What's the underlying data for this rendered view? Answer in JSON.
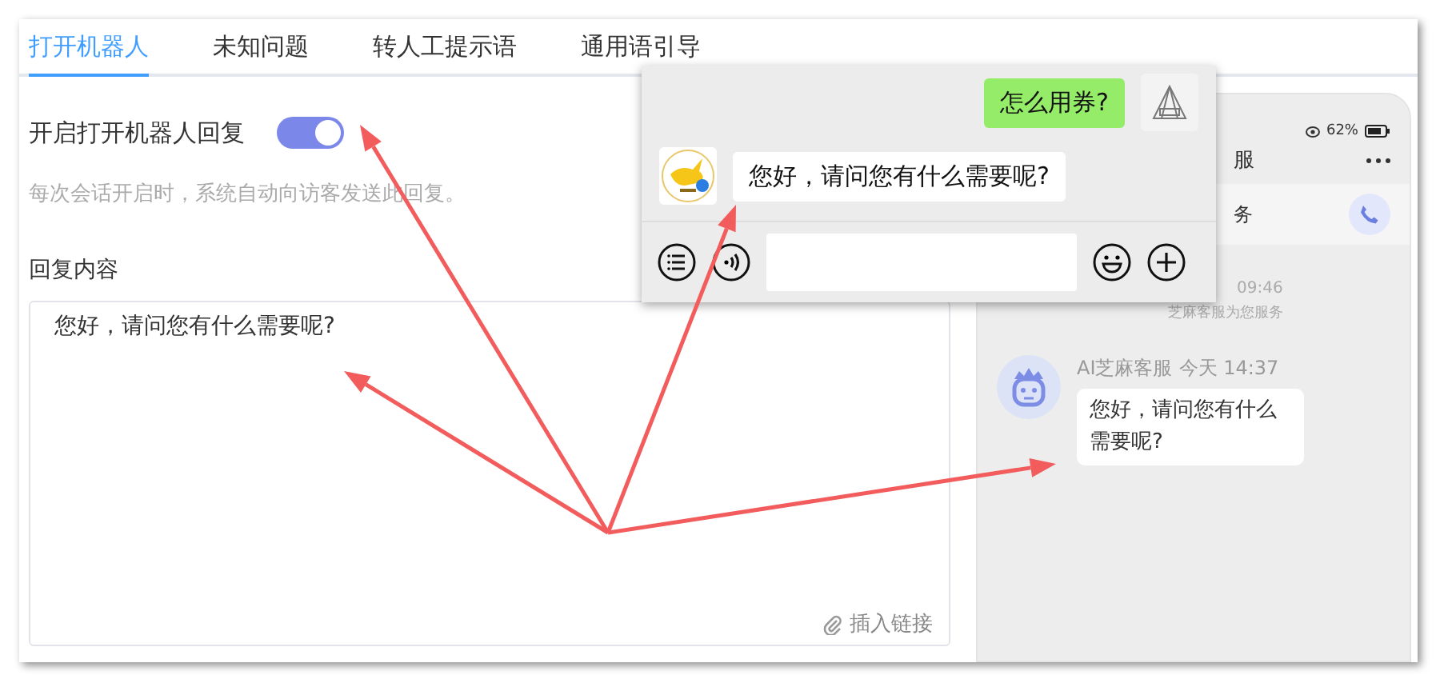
{
  "tabs": [
    {
      "label": "打开机器人",
      "selected": true
    },
    {
      "label": "未知问题",
      "selected": false
    },
    {
      "label": "转人工提示语",
      "selected": false
    },
    {
      "label": "通用语引导",
      "selected": false
    }
  ],
  "auto_reply": {
    "label": "开启打开机器人回复",
    "on": true,
    "hint": "每次会话开启时，系统自动向访客发送此回复。"
  },
  "reply_content": {
    "label": "回复内容",
    "value": "您好，请问您有什么需要呢?",
    "insert_link": "插入链接"
  },
  "chat_popup": {
    "messages": [
      {
        "kind": "sent",
        "text": "怎么用券?"
      },
      {
        "kind": "received",
        "text": "您好，请问您有什么需要呢?"
      }
    ]
  },
  "phone_preview": {
    "battery": "62%",
    "title": "服",
    "subtitle": "务",
    "time": "09:46",
    "notice": "芝麻客服为您服务",
    "message": {
      "sender": "AI芝麻客服",
      "time": "今天 14:37",
      "text": "您好，请问您有什么需要呢?"
    }
  }
}
